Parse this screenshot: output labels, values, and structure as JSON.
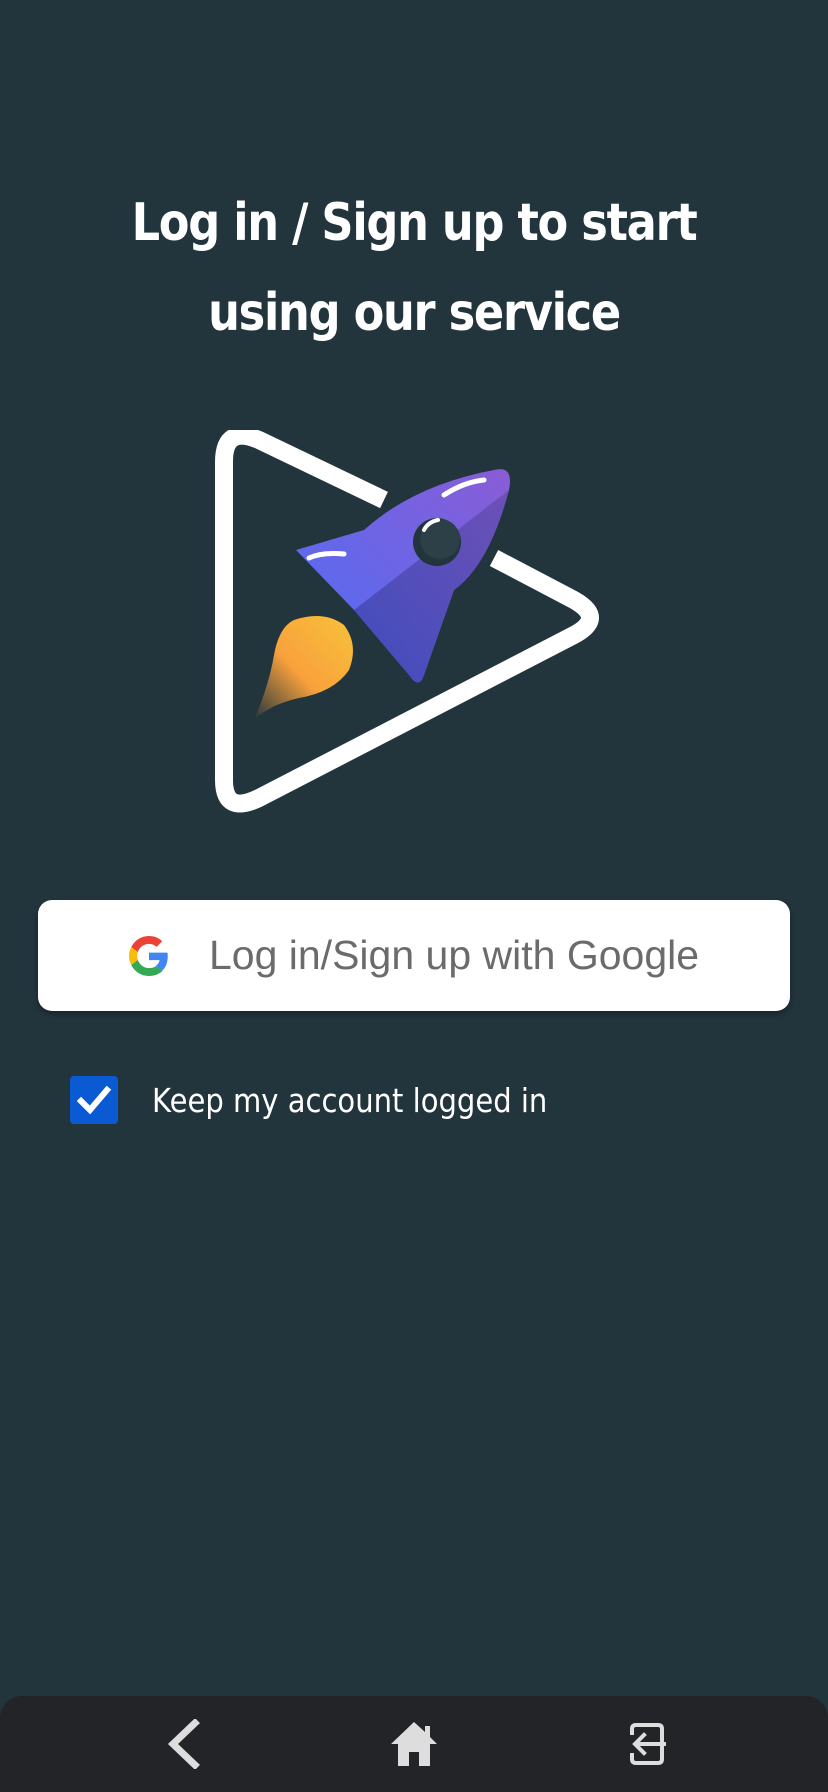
{
  "headline": {
    "line1": "Log in / Sign up to start",
    "line2": "using our service"
  },
  "hero": {
    "icon": "rocket-play-logo"
  },
  "google_button": {
    "label": "Log in/Sign up with Google",
    "icon": "google-g-icon"
  },
  "keep_logged_in": {
    "label": "Keep my account logged in",
    "checked": true,
    "color": "#0a5bd3"
  },
  "nav_bar": {
    "back_icon": "chevron-left-icon",
    "home_icon": "home-icon",
    "exit_icon": "logout-icon"
  },
  "colors": {
    "background": "#22343c",
    "navbar": "#232427",
    "button_text": "#6b6b6b"
  }
}
